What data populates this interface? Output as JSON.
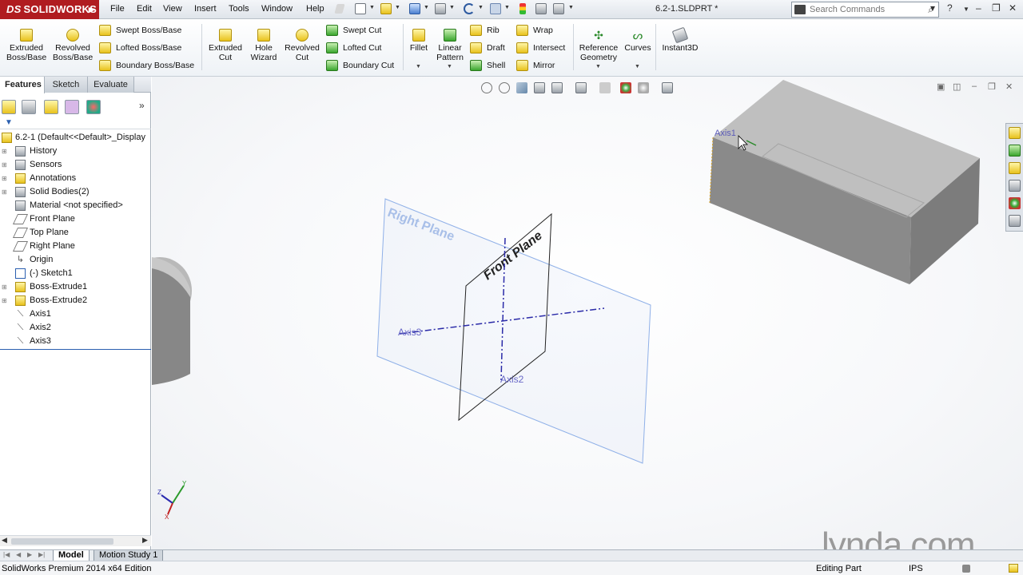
{
  "app": {
    "logo_text": "SOLIDWORKS",
    "document_title": "6.2-1.SLDPRT *"
  },
  "menu": [
    "File",
    "Edit",
    "View",
    "Insert",
    "Tools",
    "Window",
    "Help"
  ],
  "search": {
    "placeholder": "Search Commands"
  },
  "ribbon": {
    "extruded_boss": "Extruded Boss/Base",
    "revolved_boss": "Revolved Boss/Base",
    "swept_boss": "Swept Boss/Base",
    "lofted_boss": "Lofted Boss/Base",
    "boundary_boss": "Boundary Boss/Base",
    "extruded_cut": "Extruded Cut",
    "hole_wizard": "Hole Wizard",
    "revolved_cut": "Revolved Cut",
    "swept_cut": "Swept Cut",
    "lofted_cut": "Lofted Cut",
    "boundary_cut": "Boundary Cut",
    "fillet": "Fillet",
    "linear_pattern": "Linear Pattern",
    "rib": "Rib",
    "draft": "Draft",
    "shell": "Shell",
    "wrap": "Wrap",
    "intersect": "Intersect",
    "mirror": "Mirror",
    "reference_geometry": "Reference Geometry",
    "curves": "Curves",
    "instant3d": "Instant3D"
  },
  "panel_tabs": [
    "Features",
    "Sketch",
    "Evaluate"
  ],
  "tree": {
    "root": "6.2-1  (Default<<Default>_Display",
    "items": [
      "History",
      "Sensors",
      "Annotations",
      "Solid Bodies(2)",
      "Material <not specified>",
      "Front Plane",
      "Top Plane",
      "Right Plane",
      "Origin",
      "(-) Sketch1",
      "Boss-Extrude1",
      "Boss-Extrude2",
      "Axis1",
      "Axis2",
      "Axis3"
    ]
  },
  "viewport_labels": {
    "right_plane": "Right Plane",
    "front_plane": "Front Plane",
    "axis1": "Axis1",
    "axis2": "Axis2",
    "axis3": "Axis3",
    "triad_y": "Y",
    "triad_x": "X",
    "triad_z": "Z"
  },
  "bottom_tabs": [
    "Model",
    "Motion Study 1"
  ],
  "status": {
    "edition": "SolidWorks Premium 2014 x64 Edition",
    "mode": "Editing Part",
    "units": "IPS"
  },
  "watermark": "lynda.com",
  "colors": {
    "brand_red": "#b01c20",
    "plane_blue": "#8fb0e8",
    "axis_blue": "#2a2aa8",
    "body_gray": "#8a8a8a"
  }
}
